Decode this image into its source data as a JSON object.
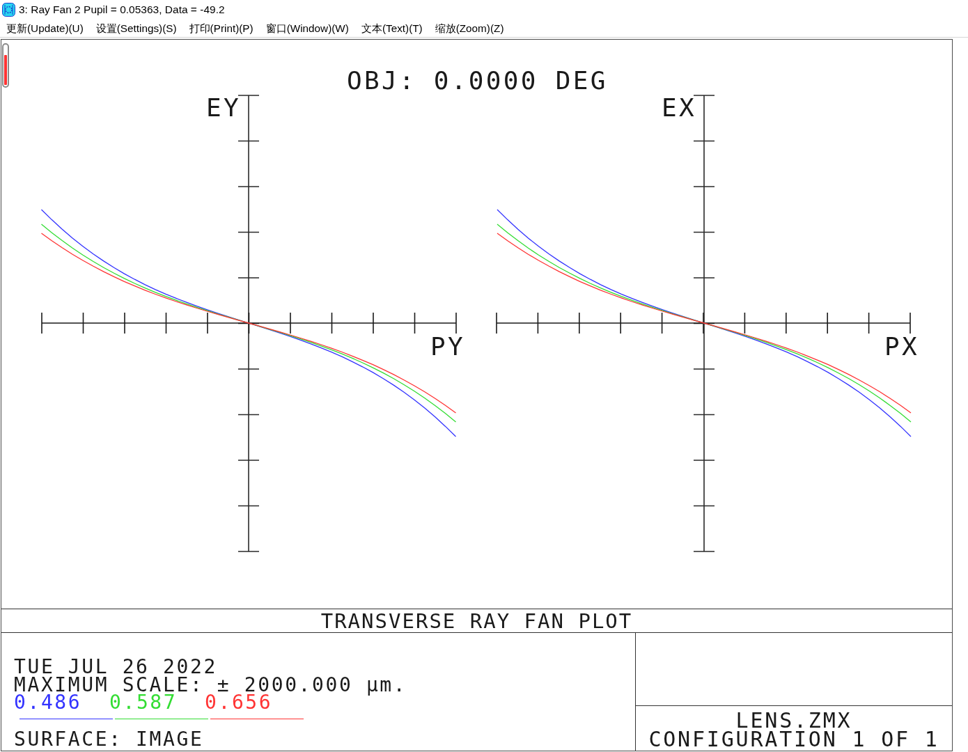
{
  "window": {
    "title": "3: Ray Fan 2 Pupil = 0.05363, Data = -49.2"
  },
  "menu": [
    "更新(Update)(U)",
    "设置(Settings)(S)",
    "打印(Print)(P)",
    "窗口(Window)(W)",
    "文本(Text)(T)",
    "缩放(Zoom)(Z)"
  ],
  "plot": {
    "heading": "OBJ: 0.0000 DEG",
    "panels": [
      {
        "vertical_axis_label": "EY",
        "horizontal_axis_label": "PY"
      },
      {
        "vertical_axis_label": "EX",
        "horizontal_axis_label": "PX"
      }
    ],
    "title": "TRANSVERSE RAY FAN PLOT"
  },
  "info": {
    "date": "TUE JUL 26 2022",
    "scale": "MAXIMUM SCALE: ± 2000.000 µm.",
    "wavelengths": [
      {
        "label": "0.486",
        "color": "#3333ff"
      },
      {
        "label": "0.587",
        "color": "#33dd33"
      },
      {
        "label": "0.656",
        "color": "#ff3333"
      }
    ],
    "surface": "SURFACE: IMAGE"
  },
  "title_block": {
    "file": "LENS.ZMX",
    "configuration": "CONFIGURATION 1 OF 1"
  }
}
